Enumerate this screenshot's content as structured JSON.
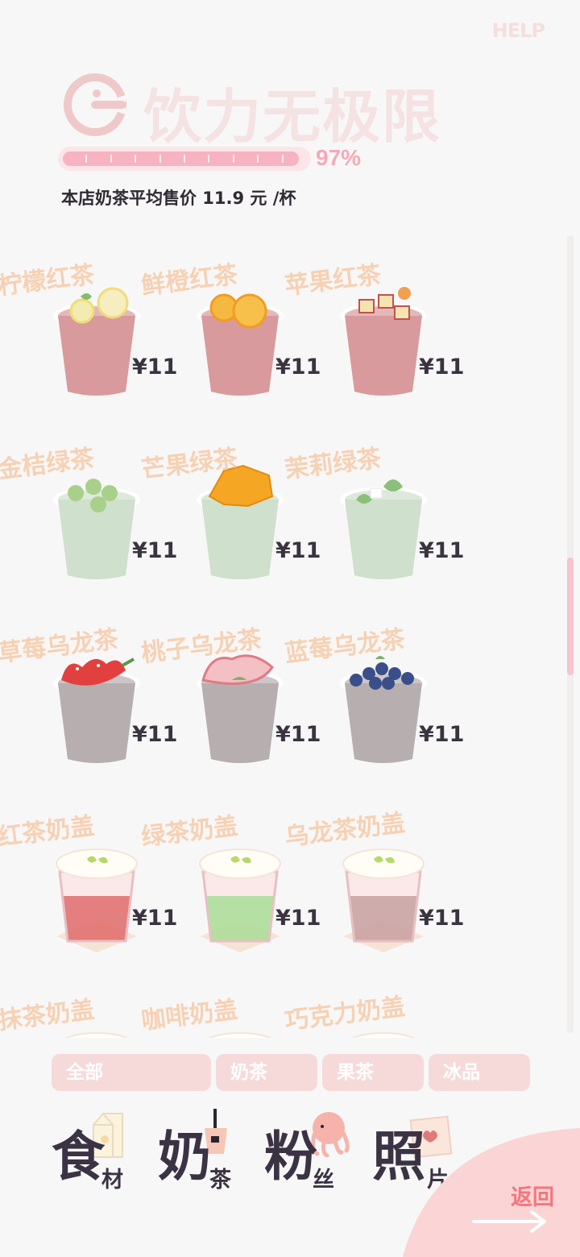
{
  "header": {
    "help": "HELP",
    "title": "饮力无极限",
    "progress_fraction": 0.97,
    "progress_label": "97%",
    "average_price": "本店奶茶平均售价 11.9 元 /杯"
  },
  "products": [
    {
      "name": "柠檬红茶",
      "price": "¥11",
      "liquid": "#d89a9c",
      "topping": "lemon"
    },
    {
      "name": "鲜橙红茶",
      "price": "¥11",
      "liquid": "#d89a9c",
      "topping": "orange"
    },
    {
      "name": "苹果红茶",
      "price": "¥11",
      "liquid": "#d89a9c",
      "topping": "apple"
    },
    {
      "name": "金桔绿茶",
      "price": "¥11",
      "liquid": "#cfe0cd",
      "topping": "kumquat"
    },
    {
      "name": "芒果绿茶",
      "price": "¥11",
      "liquid": "#cfe0cd",
      "topping": "mango"
    },
    {
      "name": "茉莉绿茶",
      "price": "¥11",
      "liquid": "#cfe0cd",
      "topping": "jasmine"
    },
    {
      "name": "草莓乌龙茶",
      "price": "¥11",
      "liquid": "#b7aeb0",
      "topping": "strawberry"
    },
    {
      "name": "桃子乌龙茶",
      "price": "¥11",
      "liquid": "#b7aeb0",
      "topping": "peach"
    },
    {
      "name": "蓝莓乌龙茶",
      "price": "¥11",
      "liquid": "#b7aeb0",
      "topping": "blueberry"
    },
    {
      "name": "红茶奶盖",
      "price": "¥11",
      "liquid": "#e06a6a",
      "topping": "cheese-foam"
    },
    {
      "name": "绿茶奶盖",
      "price": "¥11",
      "liquid": "#a9dc95",
      "topping": "cheese-foam"
    },
    {
      "name": "乌龙茶奶盖",
      "price": "¥11",
      "liquid": "#c79f9f",
      "topping": "cheese-foam"
    },
    {
      "name": "抹茶奶盖",
      "price": "",
      "liquid": "#a9dc95",
      "topping": "cheese-foam"
    },
    {
      "name": "咖啡奶盖",
      "price": "",
      "liquid": "#c9a27a",
      "topping": "cheese-foam"
    },
    {
      "name": "巧克力奶盖",
      "price": "",
      "liquid": "#8c6a5a",
      "topping": "cheese-foam"
    }
  ],
  "filter_tabs": [
    {
      "label": "全部",
      "selected": true
    },
    {
      "label": "奶茶",
      "selected": false
    },
    {
      "label": "果茶",
      "selected": false
    },
    {
      "label": "冰品",
      "selected": false
    }
  ],
  "bottom_nav": [
    {
      "big": "食",
      "small": "材",
      "icon": "milk-carton-icon"
    },
    {
      "big": "奶",
      "small": "茶",
      "icon": "bubble-tea-icon"
    },
    {
      "big": "粉",
      "small": "丝",
      "icon": "pink-character-icon"
    },
    {
      "big": "照",
      "small": "片",
      "icon": "photo-icon"
    }
  ],
  "back": {
    "label": "返回",
    "icon": "arrow-right-icon"
  },
  "colors": {
    "accent_pink": "#f7b3c2",
    "tab_bg": "#f6dada",
    "name_orange": "#f6c9a5",
    "text_dark": "#3a3340",
    "back_red": "#f3767c"
  }
}
